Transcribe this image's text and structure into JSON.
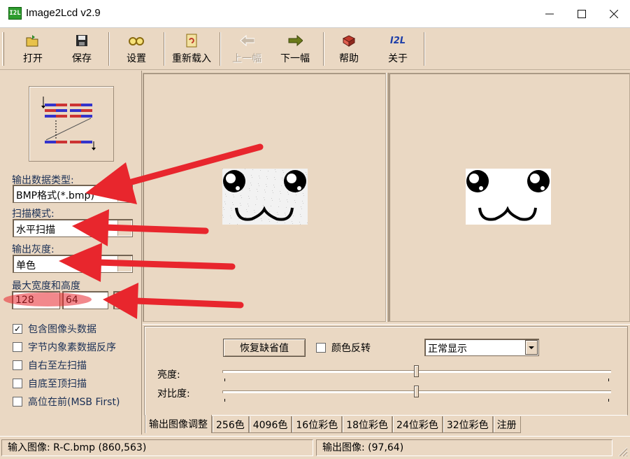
{
  "window": {
    "icon_text": "I2L",
    "title": "Image2Lcd v2.9",
    "minimize": "—",
    "maximize": "☐",
    "close": "✕"
  },
  "toolbar": {
    "open": "打开",
    "save": "保存",
    "settings": "设置",
    "reload": "重新载入",
    "prev": "上一幅",
    "next": "下一幅",
    "help": "帮助",
    "about": "关于",
    "about_icon_text": "I2L"
  },
  "left": {
    "output_type_label": "输出数据类型:",
    "output_type_value": "BMP格式(*.bmp)",
    "scan_mode_label": "扫描模式:",
    "scan_mode_value": "水平扫描",
    "gray_label": "输出灰度:",
    "gray_value": "单色",
    "max_size_label": "最大宽度和高度",
    "max_width": "128",
    "max_height": "64",
    "options": [
      {
        "label": "包含图像头数据",
        "checked": true
      },
      {
        "label": "字节内象素数据反序",
        "checked": false
      },
      {
        "label": "自右至左扫描",
        "checked": false
      },
      {
        "label": "自底至顶扫描",
        "checked": false
      },
      {
        "label": "高位在前(MSB First)",
        "checked": false
      }
    ]
  },
  "adjust": {
    "restore_default": "恢复缺省值",
    "invert_color_label": "颜色反转",
    "invert_checked": false,
    "display_mode": "正常显示",
    "brightness_label": "亮度:",
    "contrast_label": "对比度:",
    "brightness_level": 0.5,
    "contrast_level": 0.5
  },
  "tabs": [
    "输出图像调整",
    "256色",
    "4096色",
    "16位彩色",
    "18位彩色",
    "24位彩色",
    "32位彩色",
    "注册"
  ],
  "active_tab": 0,
  "status": {
    "input": "输入图像: R-C.bmp (860,563)",
    "output": "输出图像: (97,64)"
  },
  "colors": {
    "panel_bg": "#ead8c3",
    "annotation_red": "#e8262d"
  }
}
